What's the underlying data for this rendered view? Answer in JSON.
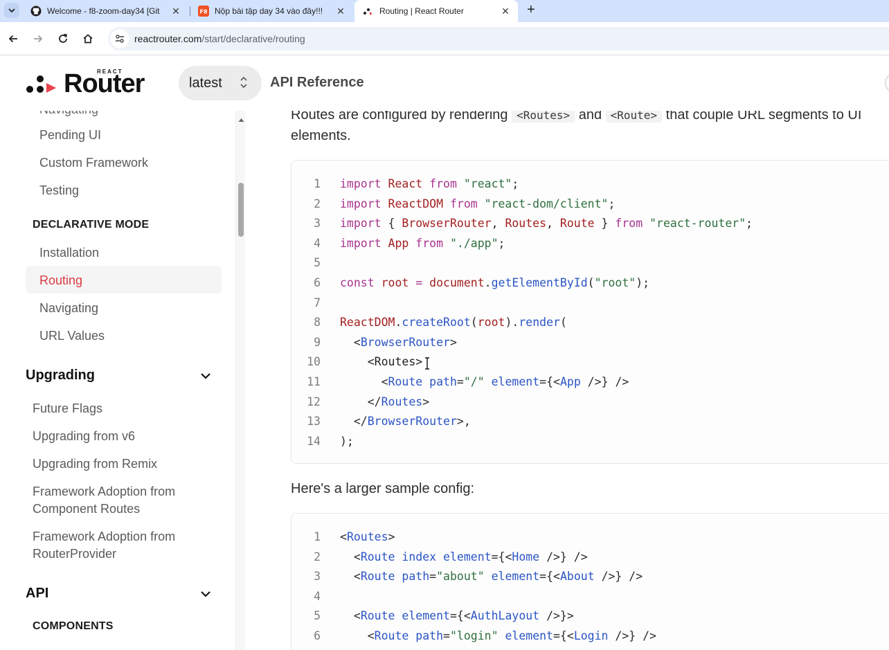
{
  "browser": {
    "tabs": [
      {
        "title": "Welcome - f8-zoom-day34 [Git",
        "icon": "github-icon",
        "active": false
      },
      {
        "title": "Nộp bài tập day 34 vào đây!!!",
        "icon": "f8-icon",
        "active": false
      },
      {
        "title": "Routing | React Router",
        "icon": "react-router-icon",
        "active": true
      }
    ],
    "url_domain": "reactrouter.com",
    "url_path": "/start/declarative/routing"
  },
  "header": {
    "logo_small": "REACT",
    "logo_word": "Router",
    "version": "latest",
    "api_reference": "API Reference"
  },
  "sidebar": {
    "partial_top": "Navigating",
    "framework_items": [
      "Pending UI",
      "Custom Framework",
      "Testing"
    ],
    "declarative_heading": "DECLARATIVE MODE",
    "declarative_items": [
      "Installation",
      "Routing",
      "Navigating",
      "URL Values"
    ],
    "active_item": "Routing",
    "upgrading_heading": "Upgrading",
    "upgrading_items": [
      "Future Flags",
      "Upgrading from v6",
      "Upgrading from Remix",
      "Framework Adoption from Component Routes",
      "Framework Adoption from RouterProvider"
    ],
    "api_heading": "API",
    "components_heading": "COMPONENTS"
  },
  "content": {
    "intro_before": "Routes are configured by rendering ",
    "intro_code1": "<Routes>",
    "intro_mid": " and ",
    "intro_code2": "<Route>",
    "intro_after": " that couple URL segments to UI",
    "intro_line2": "elements.",
    "larger_sample": "Here's a larger sample config:"
  },
  "code_block_1": [
    {
      "n": "1",
      "tokens": [
        [
          "kw",
          "import "
        ],
        [
          "id",
          "React "
        ],
        [
          "kw",
          "from "
        ],
        [
          "str",
          "\"react\""
        ],
        [
          "pl",
          ";"
        ]
      ]
    },
    {
      "n": "2",
      "tokens": [
        [
          "kw",
          "import "
        ],
        [
          "id",
          "ReactDOM "
        ],
        [
          "kw",
          "from "
        ],
        [
          "str",
          "\"react-dom/client\""
        ],
        [
          "pl",
          ";"
        ]
      ]
    },
    {
      "n": "3",
      "tokens": [
        [
          "kw",
          "import "
        ],
        [
          "pl",
          "{ "
        ],
        [
          "id",
          "BrowserRouter"
        ],
        [
          "pl",
          ", "
        ],
        [
          "id",
          "Routes"
        ],
        [
          "pl",
          ", "
        ],
        [
          "id",
          "Route "
        ],
        [
          "pl",
          "} "
        ],
        [
          "kw",
          "from "
        ],
        [
          "str",
          "\"react-router\""
        ],
        [
          "pl",
          ";"
        ]
      ]
    },
    {
      "n": "4",
      "tokens": [
        [
          "kw",
          "import "
        ],
        [
          "id",
          "App "
        ],
        [
          "kw",
          "from "
        ],
        [
          "str",
          "\"./app\""
        ],
        [
          "pl",
          ";"
        ]
      ]
    },
    {
      "n": "5",
      "tokens": []
    },
    {
      "n": "6",
      "tokens": [
        [
          "kw",
          "const "
        ],
        [
          "id",
          "root "
        ],
        [
          "kw",
          "= "
        ],
        [
          "id",
          "document"
        ],
        [
          "pl",
          "."
        ],
        [
          "fn",
          "getElementById"
        ],
        [
          "pl",
          "("
        ],
        [
          "str",
          "\"root\""
        ],
        [
          "pl",
          ");"
        ]
      ]
    },
    {
      "n": "7",
      "tokens": []
    },
    {
      "n": "8",
      "tokens": [
        [
          "id",
          "ReactDOM"
        ],
        [
          "pl",
          "."
        ],
        [
          "fn",
          "createRoot"
        ],
        [
          "pl",
          "("
        ],
        [
          "id",
          "root"
        ],
        [
          "pl",
          ")."
        ],
        [
          "fn",
          "render"
        ],
        [
          "pl",
          "("
        ]
      ]
    },
    {
      "n": "9",
      "tokens": [
        [
          "pl",
          "  <"
        ],
        [
          "tag",
          "BrowserRouter"
        ],
        [
          "pl",
          ">"
        ]
      ]
    },
    {
      "n": "10",
      "tokens": [
        [
          "pl",
          "    "
        ],
        [
          "sel",
          "<Routes>"
        ]
      ]
    },
    {
      "n": "11",
      "tokens": [
        [
          "pl",
          "      <"
        ],
        [
          "tag",
          "Route "
        ],
        [
          "attr",
          "path"
        ],
        [
          "pl",
          "="
        ],
        [
          "str",
          "\"/\" "
        ],
        [
          "attr",
          "element"
        ],
        [
          "pl",
          "={<"
        ],
        [
          "tag",
          "App "
        ],
        [
          "pl",
          "/>} />"
        ]
      ]
    },
    {
      "n": "12",
      "tokens": [
        [
          "pl",
          "    </"
        ],
        [
          "tag",
          "Routes"
        ],
        [
          "pl",
          ">"
        ]
      ]
    },
    {
      "n": "13",
      "tokens": [
        [
          "pl",
          "  </"
        ],
        [
          "tag",
          "BrowserRouter"
        ],
        [
          "pl",
          ">,"
        ]
      ]
    },
    {
      "n": "14",
      "tokens": [
        [
          "pl",
          ");"
        ]
      ]
    }
  ],
  "code_block_2": [
    {
      "n": "1",
      "tokens": [
        [
          "pl",
          "<"
        ],
        [
          "tag",
          "Routes"
        ],
        [
          "pl",
          ">"
        ]
      ]
    },
    {
      "n": "2",
      "tokens": [
        [
          "pl",
          "  <"
        ],
        [
          "tag",
          "Route "
        ],
        [
          "attr",
          "index "
        ],
        [
          "attr",
          "element"
        ],
        [
          "pl",
          "={<"
        ],
        [
          "tag",
          "Home "
        ],
        [
          "pl",
          "/>} />"
        ]
      ]
    },
    {
      "n": "3",
      "tokens": [
        [
          "pl",
          "  <"
        ],
        [
          "tag",
          "Route "
        ],
        [
          "attr",
          "path"
        ],
        [
          "pl",
          "="
        ],
        [
          "str",
          "\"about\" "
        ],
        [
          "attr",
          "element"
        ],
        [
          "pl",
          "={<"
        ],
        [
          "tag",
          "About "
        ],
        [
          "pl",
          "/>} />"
        ]
      ]
    },
    {
      "n": "4",
      "tokens": []
    },
    {
      "n": "5",
      "tokens": [
        [
          "pl",
          "  <"
        ],
        [
          "tag",
          "Route "
        ],
        [
          "attr",
          "element"
        ],
        [
          "pl",
          "={<"
        ],
        [
          "tag",
          "AuthLayout "
        ],
        [
          "pl",
          "/>}>"
        ]
      ]
    },
    {
      "n": "6",
      "tokens": [
        [
          "pl",
          "    <"
        ],
        [
          "tag",
          "Route "
        ],
        [
          "attr",
          "path"
        ],
        [
          "pl",
          "="
        ],
        [
          "str",
          "\"login\" "
        ],
        [
          "attr",
          "element"
        ],
        [
          "pl",
          "={<"
        ],
        [
          "tag",
          "Login "
        ],
        [
          "pl",
          "/>} />"
        ]
      ]
    }
  ]
}
